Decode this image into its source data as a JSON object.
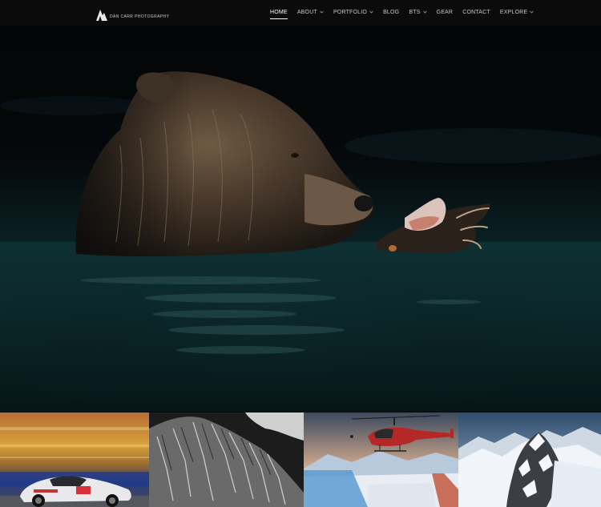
{
  "brand": {
    "name": "DAN CARR PHOTOGRAPHY",
    "logo_icon": "mountain-logo-icon"
  },
  "nav": {
    "items": [
      {
        "label": "HOME",
        "active": true,
        "dropdown": false
      },
      {
        "label": "ABOUT",
        "active": false,
        "dropdown": true
      },
      {
        "label": "PORTFOLIO",
        "active": false,
        "dropdown": true
      },
      {
        "label": "BLOG",
        "active": false,
        "dropdown": false
      },
      {
        "label": "BTS",
        "active": false,
        "dropdown": true
      },
      {
        "label": "GEAR",
        "active": false,
        "dropdown": false
      },
      {
        "label": "CONTACT",
        "active": false,
        "dropdown": false
      },
      {
        "label": "EXPLORE",
        "active": false,
        "dropdown": true
      }
    ]
  },
  "hero": {
    "subject": "grizzly bear in water eating salmon"
  },
  "thumbnails": [
    {
      "subject": "race car"
    },
    {
      "subject": "black and white mountain ridge"
    },
    {
      "subject": "helicopter over snow"
    },
    {
      "subject": "snowy mountain peaks"
    }
  ],
  "colors": {
    "nav_bg": "#0b0b0c",
    "nav_text": "#c9c9c9",
    "nav_active": "#ffffff",
    "page_bg": "#050607"
  }
}
